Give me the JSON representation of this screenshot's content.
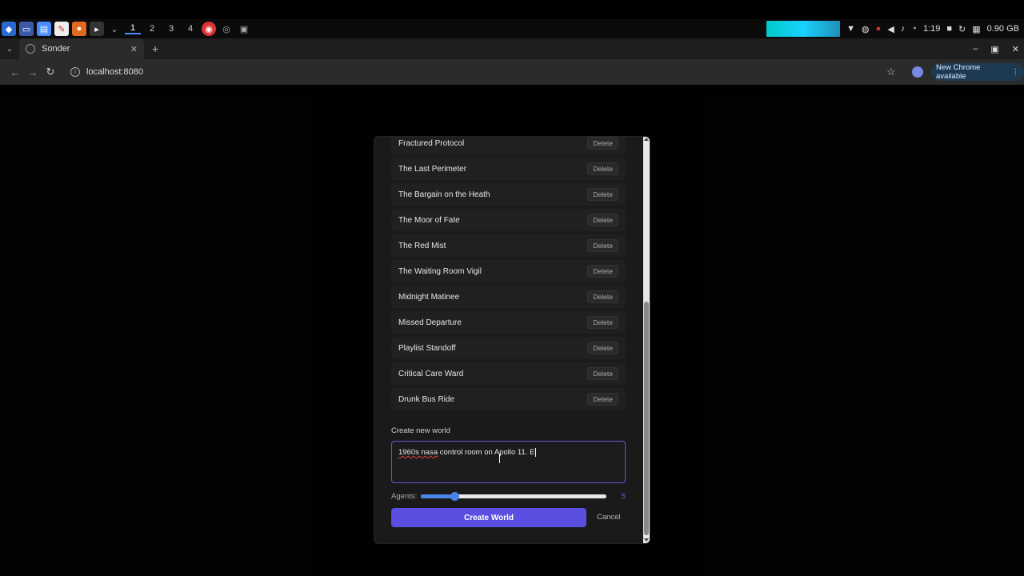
{
  "taskbar": {
    "workspaces": [
      "1",
      "2",
      "3",
      "4"
    ],
    "clock": "1:19",
    "memory": "0.90 GB"
  },
  "browser": {
    "tab_title": "Sonder",
    "url": "localhost:8080",
    "update_label": "New Chrome available"
  },
  "modal": {
    "worlds": [
      {
        "name": "Fractured Protocol",
        "action": "Delete"
      },
      {
        "name": "The Last Perimeter",
        "action": "Delete"
      },
      {
        "name": "The Bargain on the Heath",
        "action": "Delete"
      },
      {
        "name": "The Moor of Fate",
        "action": "Delete"
      },
      {
        "name": "The Red Mist",
        "action": "Delete"
      },
      {
        "name": "The Waiting Room Vigil",
        "action": "Delete"
      },
      {
        "name": "Midnight Matinee",
        "action": "Delete"
      },
      {
        "name": "Missed Departure",
        "action": "Delete"
      },
      {
        "name": "Playlist Standoff",
        "action": "Delete"
      },
      {
        "name": "Critical Care Ward",
        "action": "Delete"
      },
      {
        "name": "Drunk Bus Ride",
        "action": "Delete"
      }
    ],
    "create_section_label": "Create new world",
    "prompt_value_pre": "1960s nasa",
    "prompt_value_post": " control room on Apollo 11. E",
    "agents_label": "Agents:",
    "agents_value": "5",
    "agents_fraction": 0.18,
    "create_button": "Create World",
    "cancel_button": "Cancel"
  }
}
